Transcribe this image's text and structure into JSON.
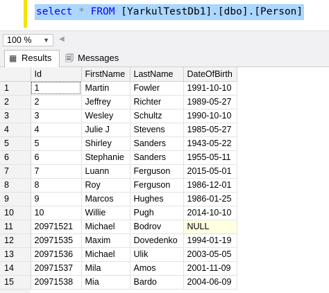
{
  "editor": {
    "query": {
      "keyword_select": "select",
      "star": "*",
      "keyword_from": "FROM",
      "target": "[YarkulTestDb1].[dbo].[Person]"
    }
  },
  "zoom": {
    "value": "100 %"
  },
  "tabs": [
    {
      "label": "Results",
      "icon": "grid-icon",
      "active": true
    },
    {
      "label": "Messages",
      "icon": "messages-icon",
      "active": false
    }
  ],
  "grid": {
    "columns": [
      "Id",
      "FirstName",
      "LastName",
      "DateOfBirth"
    ],
    "rows": [
      {
        "n": "1",
        "id": "1",
        "first": "Martin",
        "last": "Fowler",
        "dob": "1991-10-10"
      },
      {
        "n": "2",
        "id": "2",
        "first": "Jeffrey",
        "last": "Richter",
        "dob": "1989-05-27"
      },
      {
        "n": "3",
        "id": "3",
        "first": "Wesley",
        "last": "Schultz",
        "dob": "1990-10-10"
      },
      {
        "n": "4",
        "id": "4",
        "first": "Julie J",
        "last": "Stevens",
        "dob": "1985-05-27"
      },
      {
        "n": "5",
        "id": "5",
        "first": "Shirley",
        "last": "Sanders",
        "dob": "1943-05-22"
      },
      {
        "n": "6",
        "id": "6",
        "first": "Stephanie",
        "last": "Sanders",
        "dob": "1955-05-11"
      },
      {
        "n": "7",
        "id": "7",
        "first": "Luann",
        "last": "Ferguson",
        "dob": "2015-05-01"
      },
      {
        "n": "8",
        "id": "8",
        "first": "Roy",
        "last": "Ferguson",
        "dob": "1986-12-01"
      },
      {
        "n": "9",
        "id": "9",
        "first": "Marcos",
        "last": "Hughes",
        "dob": "1986-01-25"
      },
      {
        "n": "10",
        "id": "10",
        "first": "Willie",
        "last": "Pugh",
        "dob": "2014-10-10"
      },
      {
        "n": "11",
        "id": "20971521",
        "first": "Michael",
        "last": "Bodrov",
        "dob": "NULL"
      },
      {
        "n": "12",
        "id": "20971535",
        "first": "Maxim",
        "last": "Dovedenko",
        "dob": "1994-01-19"
      },
      {
        "n": "13",
        "id": "20971536",
        "first": "Michael",
        "last": "Ulik",
        "dob": "2003-05-05"
      },
      {
        "n": "14",
        "id": "20971537",
        "first": "Mila",
        "last": "Amos",
        "dob": "2001-11-09"
      },
      {
        "n": "15",
        "id": "20971538",
        "first": "Mia",
        "last": "Bardo",
        "dob": "2004-06-09"
      }
    ]
  }
}
